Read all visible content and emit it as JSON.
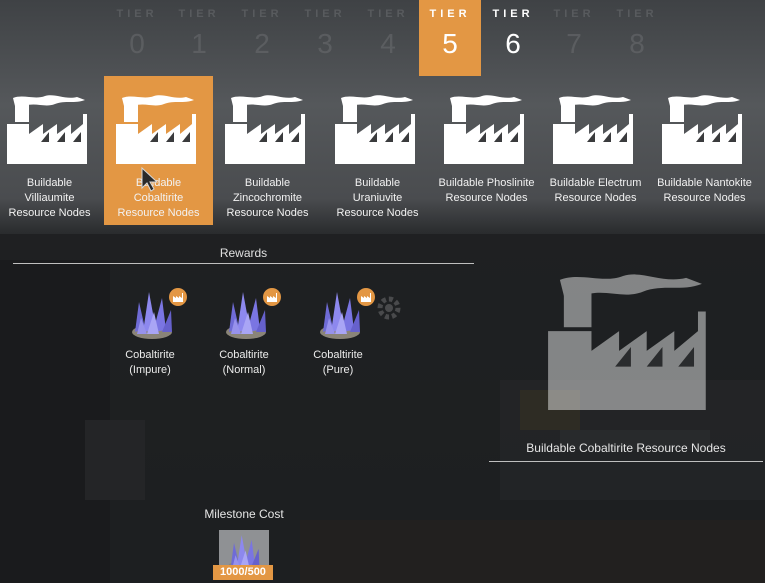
{
  "tiers": [
    {
      "label": "TIER",
      "number": "0",
      "state": "faded"
    },
    {
      "label": "TIER",
      "number": "1",
      "state": "faded"
    },
    {
      "label": "TIER",
      "number": "2",
      "state": "faded"
    },
    {
      "label": "TIER",
      "number": "3",
      "state": "faded"
    },
    {
      "label": "TIER",
      "number": "4",
      "state": "faded"
    },
    {
      "label": "TIER",
      "number": "5",
      "state": "active"
    },
    {
      "label": "TIER",
      "number": "6",
      "state": "bright"
    },
    {
      "label": "TIER",
      "number": "7",
      "state": "faded"
    },
    {
      "label": "TIER",
      "number": "8",
      "state": "faded"
    }
  ],
  "schematics": [
    {
      "lines": [
        "Buildable",
        "Villiaumite",
        "Resource Nodes"
      ],
      "selected": false
    },
    {
      "lines": [
        "Buildable",
        "Cobaltirite",
        "Resource Nodes"
      ],
      "selected": true
    },
    {
      "lines": [
        "Buildable",
        "Zincochromite",
        "Resource Nodes"
      ],
      "selected": false
    },
    {
      "lines": [
        "Buildable",
        "Uraniuvite",
        "Resource Nodes"
      ],
      "selected": false
    },
    {
      "lines": [
        "Buildable Phoslinite",
        "Resource Nodes",
        ""
      ],
      "selected": false
    },
    {
      "lines": [
        "Buildable Electrum",
        "Resource Nodes",
        ""
      ],
      "selected": false
    },
    {
      "lines": [
        "Buildable Nantokite",
        "Resource Nodes",
        ""
      ],
      "selected": false
    }
  ],
  "rewards": {
    "title": "Rewards",
    "items": [
      {
        "name": "Cobaltirite",
        "quality": "(Impure)"
      },
      {
        "name": "Cobaltirite",
        "quality": "(Normal)"
      },
      {
        "name": "Cobaltirite",
        "quality": "(Pure)"
      }
    ]
  },
  "preview": {
    "title": "Buildable Cobaltirite Resource Nodes"
  },
  "milestone_cost": {
    "title": "Milestone Cost",
    "count": "1000/500"
  },
  "colors": {
    "accent": "#e39744",
    "gem": "#7b78e0"
  },
  "icons": {
    "schematic": "factory-icon",
    "reward_badge": "factory-badge-icon",
    "cost": "cobaltirite-crystal-icon"
  }
}
